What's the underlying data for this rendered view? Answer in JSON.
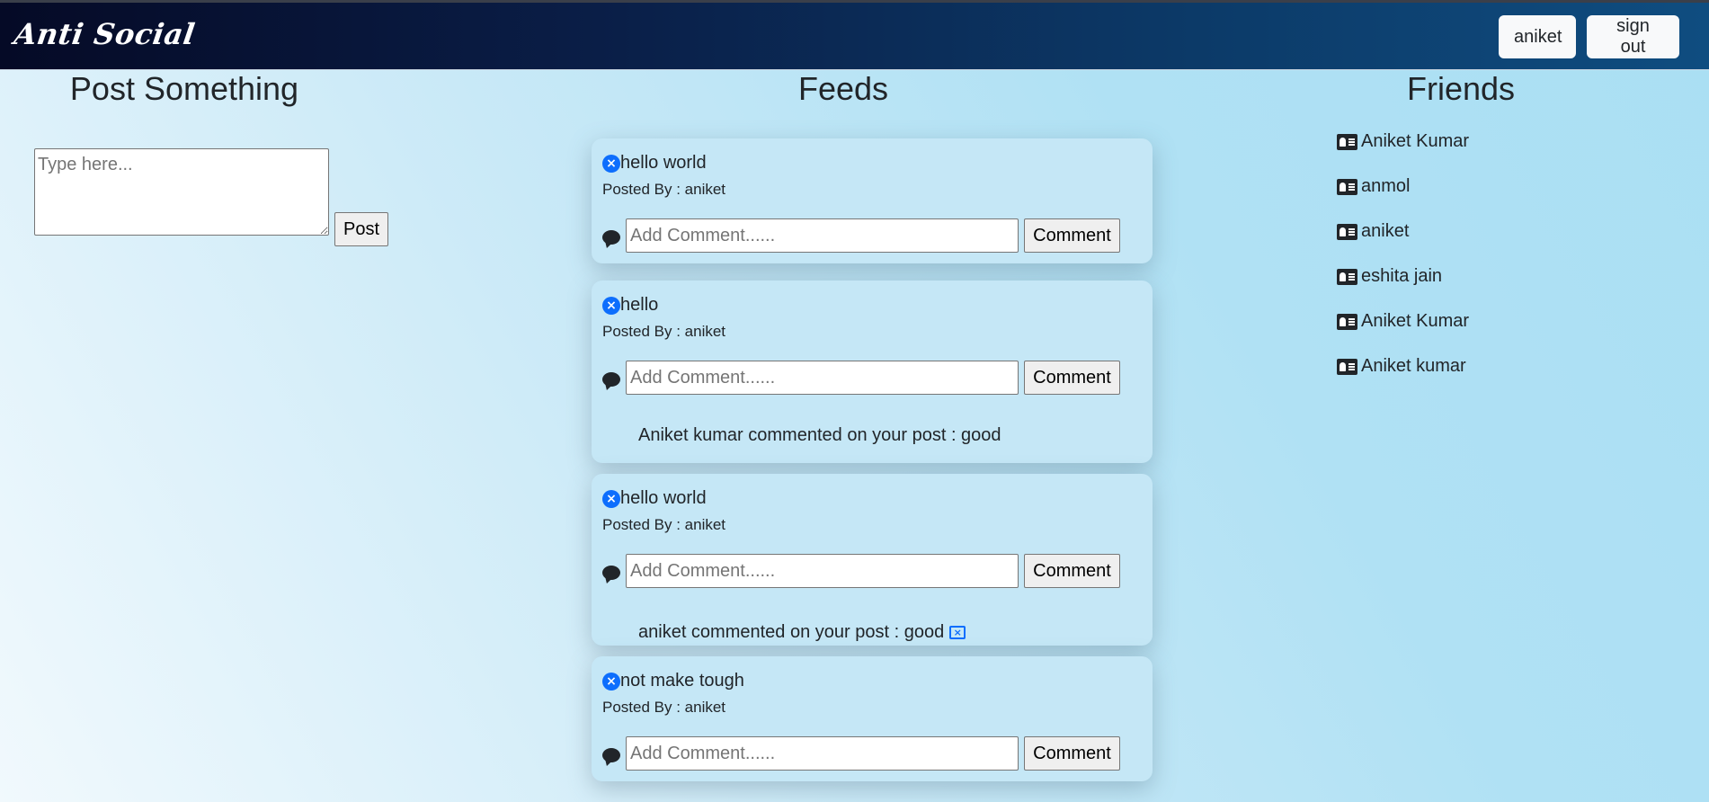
{
  "navbar": {
    "brand": "Anti Social",
    "user_button": "aniket",
    "signout_button": "sign out"
  },
  "post_section": {
    "title": "Post Something",
    "textarea_placeholder": "Type here...",
    "post_button": "Post"
  },
  "feeds": {
    "title": "Feeds",
    "comment_placeholder": "Add Comment......",
    "comment_button": "Comment",
    "posts": [
      {
        "title": "hello world",
        "posted_by": "Posted By : aniket",
        "comment": ""
      },
      {
        "title": "hello",
        "posted_by": "Posted By : aniket",
        "comment": "Aniket kumar commented on your post : good"
      },
      {
        "title": "hello world",
        "posted_by": "Posted By : aniket",
        "comment": "aniket commented on your post : good"
      },
      {
        "title": "not make tough",
        "posted_by": "Posted By : aniket",
        "comment": ""
      }
    ]
  },
  "friends": {
    "title": "Friends",
    "list": [
      "Aniket Kumar",
      "anmol",
      "aniket",
      "eshita jain",
      "Aniket Kumar",
      "Aniket kumar"
    ]
  },
  "icons": {
    "delete_post": "x-circle-icon",
    "comment": "chat-bubble-icon",
    "delete_comment": "x-square-icon",
    "friend": "person-vcard-icon"
  },
  "colors": {
    "navbar_dark": "#050a26",
    "navbar_light": "#0f4d80",
    "accent": "#0d6efd",
    "card_bg": "#c5e7f6"
  }
}
